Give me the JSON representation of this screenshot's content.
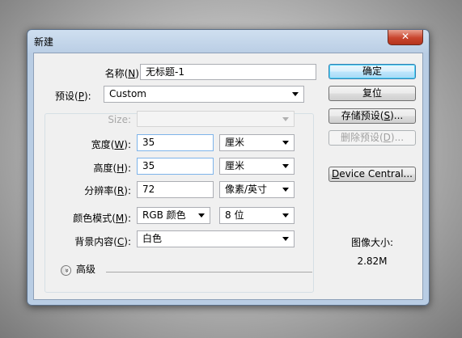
{
  "window": {
    "title": "新建",
    "close_glyph": "✕"
  },
  "form": {
    "name": {
      "label_prefix": "名称(",
      "label_key": "N",
      "label_suffix": "):",
      "value": "无标题-1"
    },
    "preset": {
      "label_prefix": "预设(",
      "label_key": "P",
      "label_suffix": "):",
      "value": "Custom"
    },
    "size": {
      "label": "Size:",
      "value": ""
    },
    "width": {
      "label_prefix": "宽度(",
      "label_key": "W",
      "label_suffix": "):",
      "value": "35",
      "unit": "厘米"
    },
    "height": {
      "label_prefix": "高度(",
      "label_key": "H",
      "label_suffix": "):",
      "value": "35",
      "unit": "厘米"
    },
    "resolution": {
      "label_prefix": "分辨率(",
      "label_key": "R",
      "label_suffix": "):",
      "value": "72",
      "unit": "像素/英寸"
    },
    "color_mode": {
      "label_prefix": "颜色模式(",
      "label_key": "M",
      "label_suffix": "):",
      "value": "RGB 颜色",
      "depth": "8 位"
    },
    "background": {
      "label_prefix": "背景内容(",
      "label_key": "C",
      "label_suffix": "):",
      "value": "白色"
    },
    "advanced": {
      "label": "高级",
      "icon": "chevron-double-down-icon"
    }
  },
  "buttons": {
    "ok": "确定",
    "reset": "复位",
    "save_preset": {
      "prefix": "存储预设(",
      "key": "S",
      "suffix": ")..."
    },
    "delete_preset": {
      "prefix": "删除预设(",
      "key": "D",
      "suffix": ")..."
    },
    "device_central": {
      "key": "D",
      "rest": "evice Central..."
    }
  },
  "image_size": {
    "label": "图像大小:",
    "value": "2.82M"
  }
}
